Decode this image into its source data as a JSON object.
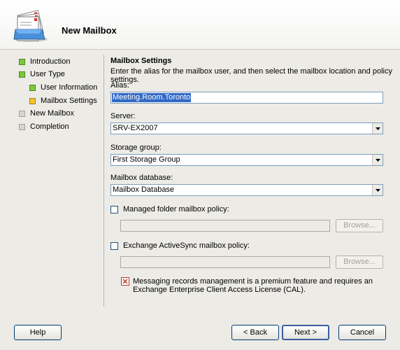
{
  "wizard": {
    "title": "New Mailbox"
  },
  "nav": {
    "items": [
      {
        "label": "Introduction",
        "status": "completed"
      },
      {
        "label": "User Type",
        "status": "completed"
      },
      {
        "label": "User Information",
        "status": "completed"
      },
      {
        "label": "Mailbox Settings",
        "status": "current"
      },
      {
        "label": "New Mailbox",
        "status": "pending"
      },
      {
        "label": "Completion",
        "status": "pending"
      }
    ]
  },
  "main": {
    "section_title": "Mailbox Settings",
    "description": "Enter the alias for the mailbox user, and then select the mailbox location and policy settings.",
    "alias": {
      "label": "Alias:",
      "value": "Meeting.Room.Toronto"
    },
    "server": {
      "label": "Server:",
      "value": "SRV-EX2007"
    },
    "storage_group": {
      "label": "Storage group:",
      "value": "First Storage Group"
    },
    "mailbox_database": {
      "label": "Mailbox database:",
      "value": "Mailbox Database"
    },
    "managed_folder": {
      "label": "Managed folder mailbox policy:",
      "checked": false,
      "browse_label": "Browse..."
    },
    "activesync": {
      "label": "Exchange ActiveSync mailbox policy:",
      "checked": false,
      "browse_label": "Browse..."
    },
    "info_text": "Messaging records management is a premium feature and requires an Exchange Enterprise Client Access License (CAL)."
  },
  "footer": {
    "help_label": "Help",
    "back_label": "< Back",
    "next_label": "Next >",
    "cancel_label": "Cancel"
  },
  "colors": {
    "completed": "#7dc73d",
    "current": "#f2c531",
    "pending": "#d6d5d0",
    "selection": "#3169c6"
  }
}
